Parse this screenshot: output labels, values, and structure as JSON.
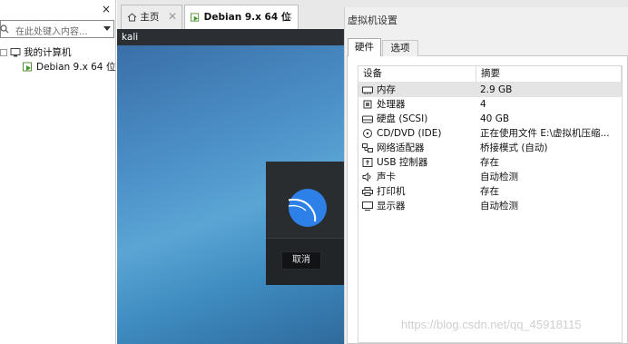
{
  "library": {
    "close_glyph": "×",
    "search_placeholder": "在此处键入内容...",
    "tree": {
      "root_label": "我的计算机",
      "vm_label": "Debian 9.x 64 位"
    }
  },
  "tabs": [
    {
      "label": "主页"
    },
    {
      "label": "Debian 9.x 64 位"
    }
  ],
  "vm": {
    "titlebar": "kali",
    "cancel_label": "取消"
  },
  "settings": {
    "title": "虚拟机设置",
    "tabs": [
      "硬件",
      "选项"
    ],
    "columns": [
      "设备",
      "摘要"
    ],
    "devices": [
      {
        "name": "内存",
        "summary": "2.9 GB",
        "icon": "memory-icon"
      },
      {
        "name": "处理器",
        "summary": "4",
        "icon": "cpu-icon"
      },
      {
        "name": "硬盘 (SCSI)",
        "summary": "40 GB",
        "icon": "disk-icon"
      },
      {
        "name": "CD/DVD (IDE)",
        "summary": "正在使用文件 E:\\虚拟机压缩...",
        "icon": "cd-icon"
      },
      {
        "name": "网络适配器",
        "summary": "桥接模式 (自动)",
        "icon": "network-icon"
      },
      {
        "name": "USB 控制器",
        "summary": "存在",
        "icon": "usb-icon"
      },
      {
        "name": "声卡",
        "summary": "自动检测",
        "icon": "sound-icon"
      },
      {
        "name": "打印机",
        "summary": "存在",
        "icon": "printer-icon"
      },
      {
        "name": "显示器",
        "summary": "自动检测",
        "icon": "display-icon"
      }
    ]
  },
  "watermark": "https://blog.csdn.net/qq_45918115"
}
